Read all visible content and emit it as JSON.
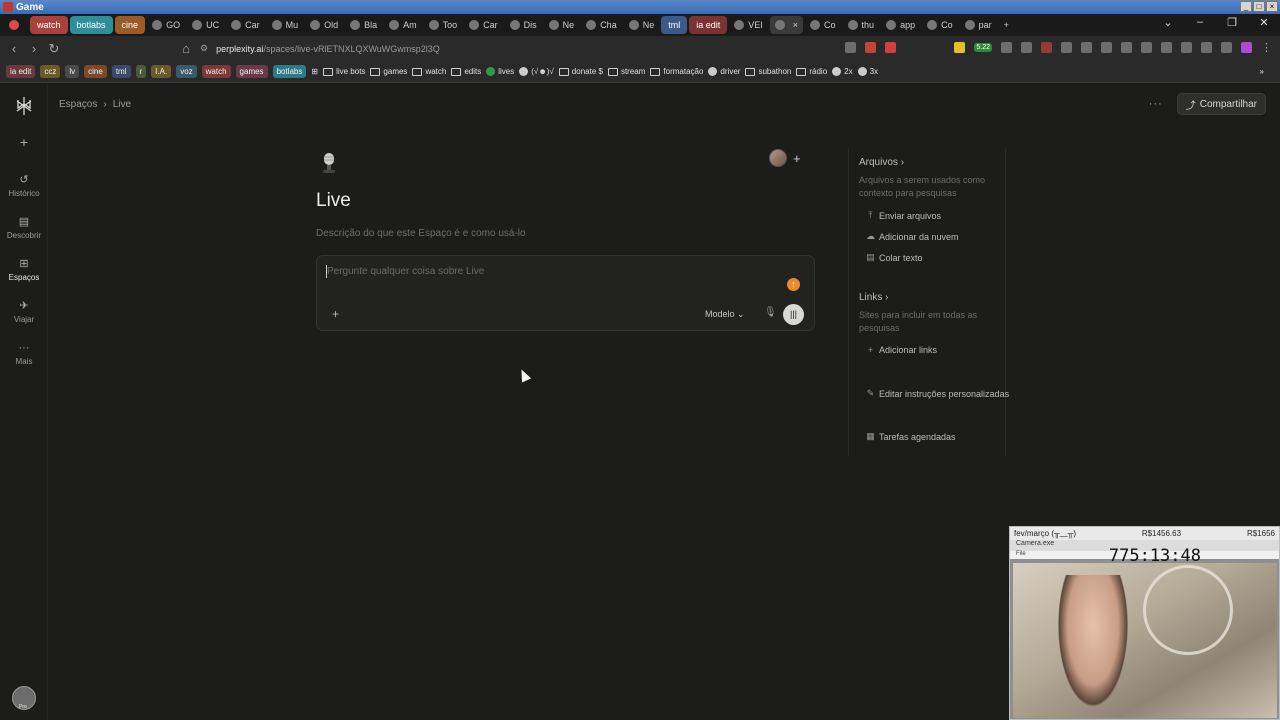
{
  "window": {
    "title": "Game",
    "controls": [
      "_",
      "□",
      "×"
    ]
  },
  "tabs": {
    "items": [
      {
        "label": "",
        "kind": "pinned",
        "color": "#e04848"
      },
      {
        "label": "watch",
        "kind": "group",
        "color": "#a8423c"
      },
      {
        "label": "botlabs",
        "kind": "group",
        "color": "#2f8f99"
      },
      {
        "label": "cine",
        "kind": "group",
        "color": "#9a5b28"
      },
      {
        "label": "GO",
        "kind": "tab"
      },
      {
        "label": "UC",
        "kind": "tab"
      },
      {
        "label": "Car",
        "kind": "tab"
      },
      {
        "label": "Mu",
        "kind": "tab"
      },
      {
        "label": "Old",
        "kind": "tab"
      },
      {
        "label": "Bla",
        "kind": "tab"
      },
      {
        "label": "Am",
        "kind": "tab"
      },
      {
        "label": "Too",
        "kind": "tab"
      },
      {
        "label": "Car",
        "kind": "tab"
      },
      {
        "label": "Dis",
        "kind": "tab"
      },
      {
        "label": "Ne",
        "kind": "tab"
      },
      {
        "label": "Cha",
        "kind": "tab"
      },
      {
        "label": "Ne",
        "kind": "tab"
      },
      {
        "label": "tml",
        "kind": "group",
        "color": "#3b5a8a"
      },
      {
        "label": "ia edit",
        "kind": "group",
        "color": "#7a3232"
      },
      {
        "label": "VEI",
        "kind": "tab"
      },
      {
        "label": "",
        "kind": "tab-active"
      },
      {
        "label": "Co",
        "kind": "tab"
      },
      {
        "label": "thu",
        "kind": "tab"
      },
      {
        "label": "app",
        "kind": "tab"
      },
      {
        "label": "Co",
        "kind": "tab"
      },
      {
        "label": "par",
        "kind": "tab"
      }
    ],
    "close_label": "×",
    "new_tab_label": "+"
  },
  "address": {
    "host": "perplexity.ai",
    "path": "/spaces/live-vRlETNXLQXWuWGwmsp2l3Q",
    "badge": "5.22"
  },
  "bookmarks": {
    "chips": [
      {
        "label": "ia edit",
        "color": "#6a3a3a"
      },
      {
        "label": "ccz",
        "color": "#6a5a2a"
      },
      {
        "label": "lv",
        "color": "#4a4a4a"
      },
      {
        "label": "cine",
        "color": "#7a4a2a"
      },
      {
        "label": "tml",
        "color": "#3a4a6a"
      },
      {
        "label": "r",
        "color": "#4a5a3a"
      },
      {
        "label": "I.A.",
        "color": "#6a5a2a"
      },
      {
        "label": "voz",
        "color": "#3a5a6a"
      },
      {
        "label": "watch",
        "color": "#7a3a3a"
      },
      {
        "label": "games",
        "color": "#6a3a4a"
      },
      {
        "label": "botlabs",
        "color": "#2f7a85"
      }
    ],
    "items": [
      {
        "label": "live bots",
        "icon": "folder"
      },
      {
        "label": "games",
        "icon": "folder"
      },
      {
        "label": "watch",
        "icon": "folder"
      },
      {
        "label": "edits",
        "icon": "folder"
      },
      {
        "label": "lives",
        "icon": "sheet"
      },
      {
        "label": "(√☻)√",
        "icon": "dot"
      },
      {
        "label": "donate $",
        "icon": "folder"
      },
      {
        "label": "stream",
        "icon": "folder"
      },
      {
        "label": "formatação",
        "icon": "folder"
      },
      {
        "label": "driver",
        "icon": "dot"
      },
      {
        "label": "subathon",
        "icon": "folder"
      },
      {
        "label": "rádio",
        "icon": "folder"
      },
      {
        "label": "2x",
        "icon": "dot"
      },
      {
        "label": "3x",
        "icon": "dot"
      }
    ]
  },
  "sidebar": {
    "items": [
      {
        "label": "Histórico",
        "icon": "history-icon"
      },
      {
        "label": "Descobrir",
        "icon": "discover-icon"
      },
      {
        "label": "Espaços",
        "icon": "spaces-icon"
      },
      {
        "label": "Viajar",
        "icon": "travel-icon"
      },
      {
        "label": "Mais",
        "icon": "more-icon"
      }
    ],
    "pro_label": "Pro"
  },
  "breadcrumb": {
    "root": "Espaços",
    "separator": "›",
    "current": "Live"
  },
  "header": {
    "share_label": "Compartilhar"
  },
  "space": {
    "title": "Live",
    "description_placeholder": "Descrição do que este Espaço é e como usá-lo"
  },
  "ask": {
    "placeholder": "Pergunte qualquer coisa sobre Live",
    "model_label": "Modelo"
  },
  "panel": {
    "files": {
      "title": "Arquivos",
      "description": "Arquivos a serem usados como contexto para pesquisas",
      "actions": [
        "Enviar arquivos",
        "Adicionar da nuvem",
        "Colar texto"
      ]
    },
    "links": {
      "title": "Links",
      "description": "Sites para incluir em todas as pesquisas",
      "action": "Adicionar links"
    },
    "custom_instructions": "Editar instruções personalizadas",
    "scheduled_tasks": "Tarefas agendadas"
  },
  "webcam": {
    "header_left": "fev/março (╥﹏╥)",
    "header_mid": "R$1456.63",
    "header_right": "R$1656",
    "window_label": "Camera.exe",
    "menu_label": "File",
    "timer": "775:13:48"
  },
  "colors": {
    "background": "#1c1c1b",
    "accent_orange": "#e98b2c",
    "titlebar_blue": "#3a6bb5"
  }
}
